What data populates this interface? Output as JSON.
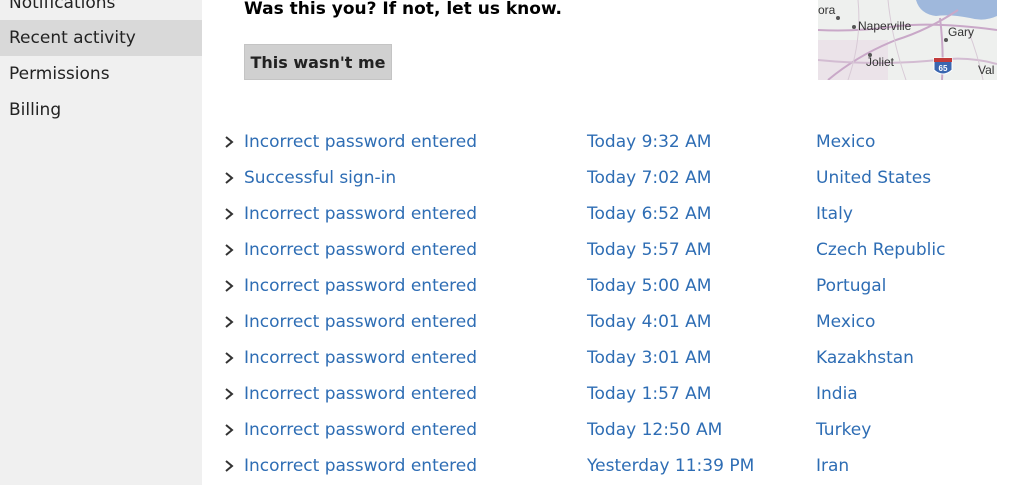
{
  "sidebar": {
    "items": [
      {
        "label": "Notifications",
        "selected": false
      },
      {
        "label": "Recent activity",
        "selected": true
      },
      {
        "label": "Permissions",
        "selected": false
      },
      {
        "label": "Billing",
        "selected": false
      }
    ]
  },
  "main": {
    "prompt": "Was this you? If not, let us know.",
    "button_label": "This wasn't me",
    "map": {
      "labels": [
        "ora",
        "Naperville",
        "Gary",
        "Joliet",
        "65",
        "Val"
      ],
      "accent_water": "#9fb8dc",
      "shield_color": "#3a66b0"
    }
  },
  "activity": {
    "link_color": "#2e6db4",
    "rows": [
      {
        "event": "Incorrect password entered",
        "time": "Today 9:32 AM",
        "location": "Mexico"
      },
      {
        "event": "Successful sign-in",
        "time": "Today 7:02 AM",
        "location": "United States"
      },
      {
        "event": "Incorrect password entered",
        "time": "Today 6:52 AM",
        "location": "Italy"
      },
      {
        "event": "Incorrect password entered",
        "time": "Today 5:57 AM",
        "location": "Czech Republic"
      },
      {
        "event": "Incorrect password entered",
        "time": "Today 5:00 AM",
        "location": "Portugal"
      },
      {
        "event": "Incorrect password entered",
        "time": "Today 4:01 AM",
        "location": "Mexico"
      },
      {
        "event": "Incorrect password entered",
        "time": "Today 3:01 AM",
        "location": "Kazakhstan"
      },
      {
        "event": "Incorrect password entered",
        "time": "Today 1:57 AM",
        "location": "India"
      },
      {
        "event": "Incorrect password entered",
        "time": "Today 12:50 AM",
        "location": "Turkey"
      },
      {
        "event": "Incorrect password entered",
        "time": "Yesterday 11:39 PM",
        "location": "Iran"
      }
    ]
  }
}
